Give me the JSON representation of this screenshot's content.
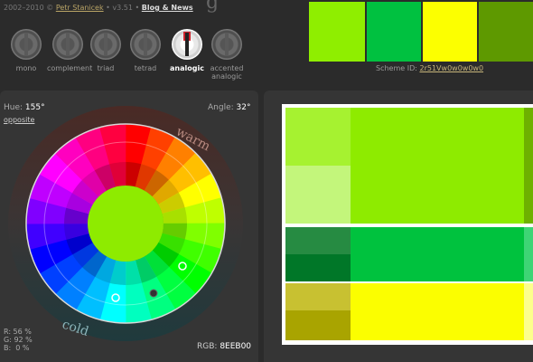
{
  "header": {
    "copyright": "2002–2010 ©",
    "author": "Petr Stanicek",
    "version": "• v3.51 •",
    "blog_link": "Blog & News",
    "brand_tail": "g"
  },
  "modes": [
    {
      "label": "mono",
      "active": false
    },
    {
      "label": "complement",
      "active": false
    },
    {
      "label": "triad",
      "active": false
    },
    {
      "label": "tetrad",
      "active": false
    },
    {
      "label": "analogic",
      "active": true
    },
    {
      "label": "accented\nanalogic",
      "active": false
    }
  ],
  "swatches": [
    "#8FEE00",
    "#00C140",
    "#FCFF00",
    "#5E9900"
  ],
  "scheme": {
    "label": "Scheme ID:",
    "value": "2r51Vw0w0w0w0"
  },
  "wheel": {
    "hue_label": "Hue:",
    "hue_value": "155°",
    "angle_label": "Angle:",
    "angle_value": "32°",
    "opposite_link": "opposite",
    "warm_label": "warm",
    "cold_label": "cold",
    "center_color": "#8EEB00",
    "rgb_mix": [
      "R: 56 %",
      "G: 92 %",
      "B:  0 %"
    ],
    "rgb_label": "RGB:",
    "rgb_value": "8EEB00"
  },
  "preview": {
    "col1": [
      "#A6F230",
      "#C3F67B",
      "#268B42",
      "#007728",
      "#C8C131",
      "#A9A400"
    ],
    "col2": [
      "#8EEB00",
      "#00C23E",
      "#FBFE00"
    ],
    "col3": [
      "#6EB100",
      "#3ED575",
      "#FCFF8C"
    ]
  }
}
